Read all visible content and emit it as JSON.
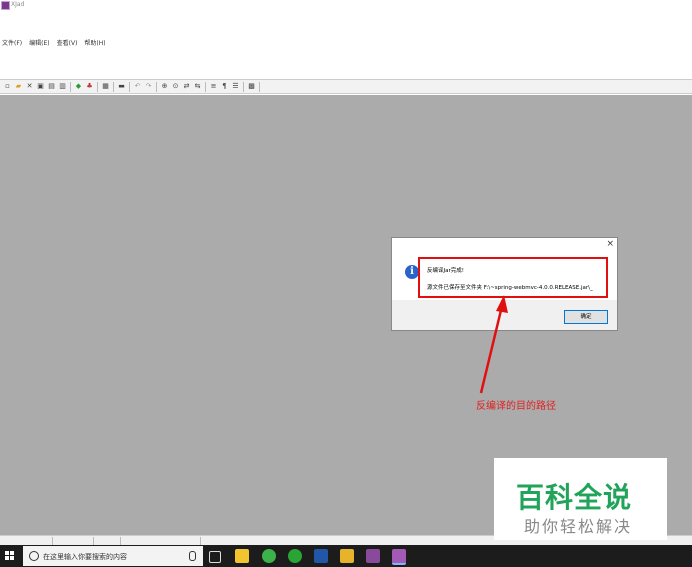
{
  "window": {
    "title": "XJad"
  },
  "menu": [
    "文件(F)",
    "编辑(E)",
    "查看(V)",
    "帮助(H)"
  ],
  "toolbar_icons": [
    "new-file",
    "open-folder",
    "delete",
    "save",
    "save-all",
    "copy",
    "diamond",
    "decompile",
    "paste",
    "print",
    "undo",
    "redo",
    "find",
    "find-next",
    "replace",
    "replace-all",
    "align",
    "format",
    "list",
    "options"
  ],
  "dialog": {
    "close": "×",
    "icon": "i",
    "line1": "反编译Jar完成!",
    "line2": "源文件已保存至文件夹 F:\\~spring-webmvc-4.0.0.RELEASE.jar\\_",
    "ok_label": "确定"
  },
  "annotation": "反编译的目的路径",
  "watermark": {
    "title": "百科全说",
    "subtitle": "助你轻松解决"
  },
  "taskbar": {
    "search_placeholder": "在这里输入你要搜索的内容"
  },
  "colors": {
    "workspace": "#ababab",
    "annotation_red": "#e02020",
    "watermark_green": "#22a35a"
  }
}
